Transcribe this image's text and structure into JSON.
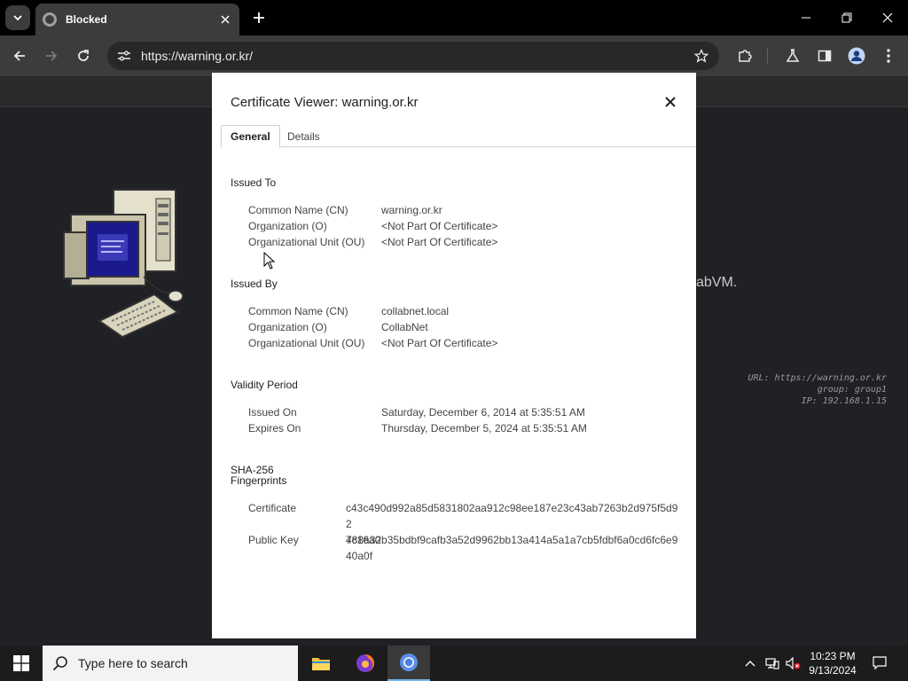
{
  "browser": {
    "tab_title": "Blocked",
    "url": "https://warning.or.kr/"
  },
  "background_page": {
    "partial_text": "abVM.",
    "info_url": "URL: https://warning.or.kr",
    "info_group": "group: group1",
    "info_ip": "IP: 192.168.1.15"
  },
  "dialog": {
    "title": "Certificate Viewer: warning.or.kr",
    "tabs": [
      {
        "label": "General",
        "active": true
      },
      {
        "label": "Details",
        "active": false
      }
    ],
    "issued_to": {
      "heading": "Issued To",
      "rows": [
        {
          "label": "Common Name (CN)",
          "value": "warning.or.kr"
        },
        {
          "label": "Organization (O)",
          "value": "<Not Part Of Certificate>"
        },
        {
          "label": "Organizational Unit (OU)",
          "value": "<Not Part Of Certificate>"
        }
      ]
    },
    "issued_by": {
      "heading": "Issued By",
      "rows": [
        {
          "label": "Common Name (CN)",
          "value": "collabnet.local"
        },
        {
          "label": "Organization (O)",
          "value": "CollabNet"
        },
        {
          "label": "Organizational Unit (OU)",
          "value": "<Not Part Of Certificate>"
        }
      ]
    },
    "validity": {
      "heading": "Validity Period",
      "rows": [
        {
          "label": "Issued On",
          "value": "Saturday, December 6, 2014 at 5:35:51 AM"
        },
        {
          "label": "Expires On",
          "value": "Thursday, December 5, 2024 at 5:35:51 AM"
        }
      ]
    },
    "fingerprints": {
      "heading_line1": "SHA-256",
      "heading_line2": "Fingerprints",
      "rows": [
        {
          "label": "Certificate",
          "value_line1": "c43c490d992a85d5831802aa912c98ee187e23c43ab7263b2d975f5d92",
          "value_line2": "4c16a0"
        },
        {
          "label": "Public Key",
          "value_line1": "788a32b35bdbf9cafb3a52d9962bb13a414a5a1a7cb5fdbf6a0cd6fc6e9",
          "value_line2": "40a0f"
        }
      ]
    }
  },
  "taskbar": {
    "search_placeholder": "Type here to search",
    "time": "10:23 PM",
    "date": "9/13/2024"
  },
  "colors": {
    "chrome_dark": "#3c3c3c",
    "dialog_bg": "#ffffff",
    "taskbar": "#1c1c1c",
    "active_indicator": "#76b9ed"
  }
}
